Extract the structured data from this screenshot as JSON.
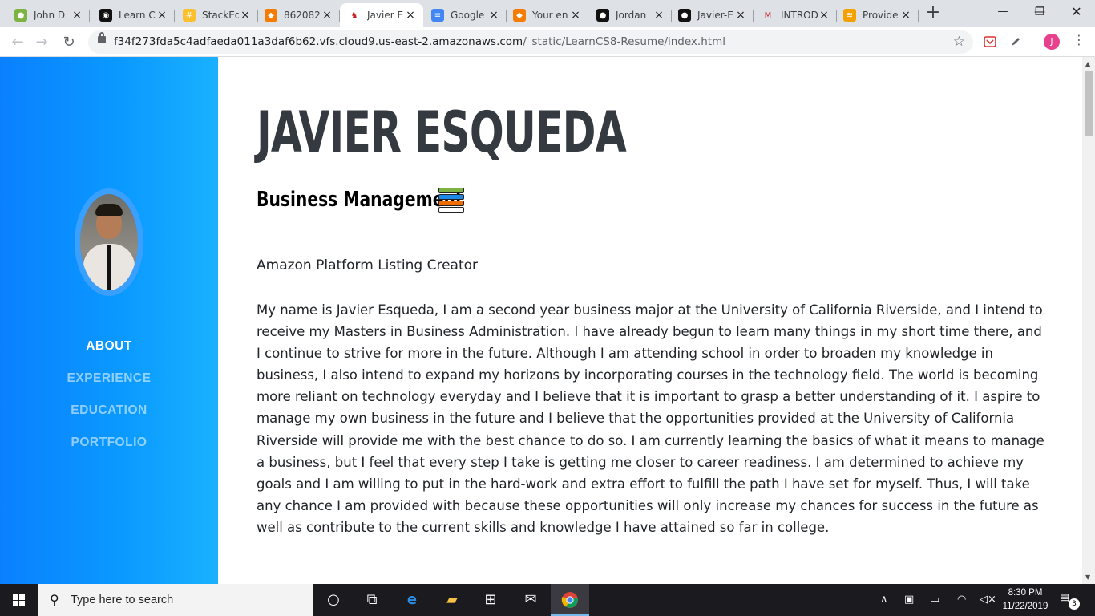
{
  "browser": {
    "tabs": [
      {
        "label": "John D",
        "icon": "avocado-icon",
        "color": "#7cb342",
        "glyph": "●"
      },
      {
        "label": "Learn C",
        "icon": "owl-icon",
        "color": "#111111",
        "glyph": "◉"
      },
      {
        "label": "StackEd",
        "icon": "stackedit-icon",
        "color": "#fbc02d",
        "glyph": "#"
      },
      {
        "label": "862082",
        "icon": "cube-icon",
        "color": "#f57c00",
        "glyph": "◆"
      },
      {
        "label": "Javier E",
        "icon": "person-icon",
        "color": "#ffffff",
        "glyph": "♞",
        "active": true
      },
      {
        "label": "Google",
        "icon": "google-docs-icon",
        "color": "#4285f4",
        "glyph": "≡"
      },
      {
        "label": "Your en",
        "icon": "cube-icon",
        "color": "#f57c00",
        "glyph": "◆"
      },
      {
        "label": "Jordan",
        "icon": "github-icon",
        "color": "#111111",
        "glyph": "●"
      },
      {
        "label": "Javier-E",
        "icon": "github-icon",
        "color": "#111111",
        "glyph": "●"
      },
      {
        "label": "INTROD",
        "icon": "gmail-icon",
        "color": "#ffffff",
        "glyph": "M"
      },
      {
        "label": "Provide",
        "icon": "stack-icon",
        "color": "#f4a100",
        "glyph": "≋"
      }
    ],
    "new_tab": "+",
    "window_controls": {
      "minimize": "—",
      "restore": "❐",
      "close": "✕"
    },
    "url_host": "f34f273fda5c4adfaeda011a3daf6b62.vfs.cloud9.us-east-2.amazonaws.com",
    "url_path": "/_static/LearnCS8-Resume/index.html",
    "profile_initial": "J"
  },
  "sidebar": {
    "nav": [
      {
        "label": "ABOUT",
        "active": true
      },
      {
        "label": "EXPERIENCE",
        "active": false
      },
      {
        "label": "EDUCATION",
        "active": false
      },
      {
        "label": "PORTFOLIO",
        "active": false
      }
    ]
  },
  "content": {
    "name": "JAVIER ESQUEDA",
    "subtitle": "Business Management",
    "intro": "Amazon Platform Listing Creator",
    "bio": "My name is Javier Esqueda, I am a second year business major at the University of California Riverside, and I intend to receive my Masters in Business Administration. I have already begun to learn many things in my short time there, and I continue to strive for more in the future. Although I am attending school in order to broaden my knowledge in business, I also intend to expand my horizons by incorporating courses in the technology field. The world is becoming more reliant on technology everyday and I believe that it is important to grasp a better understanding of it. I aspire to manage my own business in the future and I believe that the opportunities provided at the University of California Riverside will provide me with the best chance to do so. I am currently learning the basics of what it means to manage a business, but I feel that every step I take is getting me closer to career readiness. I am determined to achieve my goals and I am willing to put in the hard-work and extra effort to fulfill the path I have set for myself. Thus, I will take any chance I am provided with because these opportunities will only increase my chances for success in the future as well as contribute to the current skills and knowledge I have attained so far in college."
  },
  "taskbar": {
    "search_placeholder": "Type here to search",
    "time": "8:30 PM",
    "date": "11/22/2019",
    "notifications": "3"
  },
  "colors": {
    "sidebar": "#0a99ff",
    "heading": "#343a40",
    "body_text": "#212529"
  }
}
